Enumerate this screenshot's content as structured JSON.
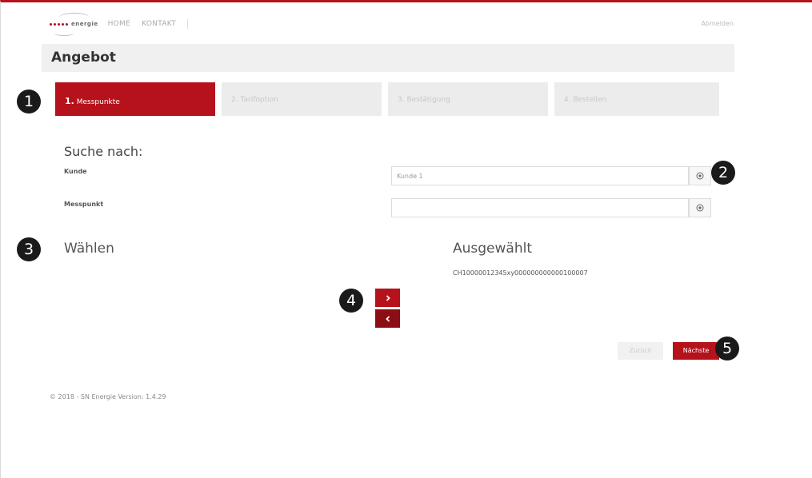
{
  "colors": {
    "accent": "#b5121b",
    "accent_dark": "#8c0d14",
    "header_bg": "#f0f0f0",
    "step_inactive": "#ececec"
  },
  "nav": {
    "logo_text": "energie",
    "links": [
      "HOME",
      "KONTAKT"
    ],
    "logout": "Abmelden"
  },
  "page": {
    "title": "Angebot"
  },
  "steps": [
    {
      "num": "1.",
      "label": "Messpunkte",
      "active": true
    },
    {
      "num": "2.",
      "label": "Tarifoption",
      "active": false
    },
    {
      "num": "3.",
      "label": "Bestätigung",
      "active": false
    },
    {
      "num": "4.",
      "label": "Bestellen",
      "active": false
    }
  ],
  "search": {
    "heading": "Suche nach:",
    "customer_label": "Kunde",
    "customer_value": "Kunde 1",
    "meter_label": "Messpunkt",
    "meter_value": "",
    "clear_icon": "clear-circle-icon"
  },
  "lists": {
    "available_heading": "Wählen",
    "selected_heading": "Ausgewählt",
    "selected_items": [
      "CH10000012345xy000000000000100007"
    ]
  },
  "actions": {
    "move_right_icon": "chevron-right-icon",
    "move_left_icon": "chevron-left-icon",
    "back_label": "Zurück",
    "next_label": "Nächste"
  },
  "callouts": [
    "1",
    "2",
    "3",
    "4",
    "5"
  ],
  "footer": {
    "text": "© 2018 - SN Energie Version: 1.4.29"
  }
}
